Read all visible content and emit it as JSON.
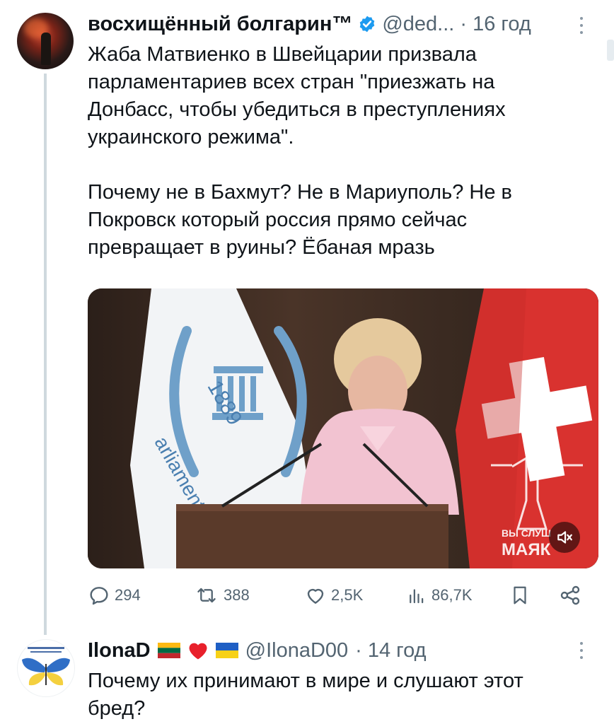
{
  "post": {
    "author_name": "восхищённый болгарин™",
    "handle": "@ded...",
    "time": "· 16 год",
    "text": "Жаба Матвиенко в Швейцарии призвала\nпарламентариев всех стран \"приезжать на\nДонбасс, чтобы убедиться в преступлениях\nукраинского режима\".\n\nПочему не в Бахмут? Не в Мариуполь? Не в\nПокровск который россия прямо сейчас\nпревращает в руины? Ёбаная мразь",
    "video": {
      "watermark_line1": "ВЫ СЛУШ",
      "watermark_line2": "МАЯК",
      "podium_year": "1889",
      "flag_text": "arliamenta"
    },
    "stats": {
      "replies": "294",
      "reposts": "388",
      "likes": "2,5K",
      "views": "86,7K"
    }
  },
  "reply": {
    "author_name": "IlonaD",
    "handle": "@IlonaD00",
    "time": "· 14 год",
    "text": "Почему их принимают в мире и слушают этот\nбред?"
  },
  "colors": {
    "accent": "#1d9bf0",
    "secondary_text": "#536471",
    "thread_line": "#cfd9de"
  }
}
